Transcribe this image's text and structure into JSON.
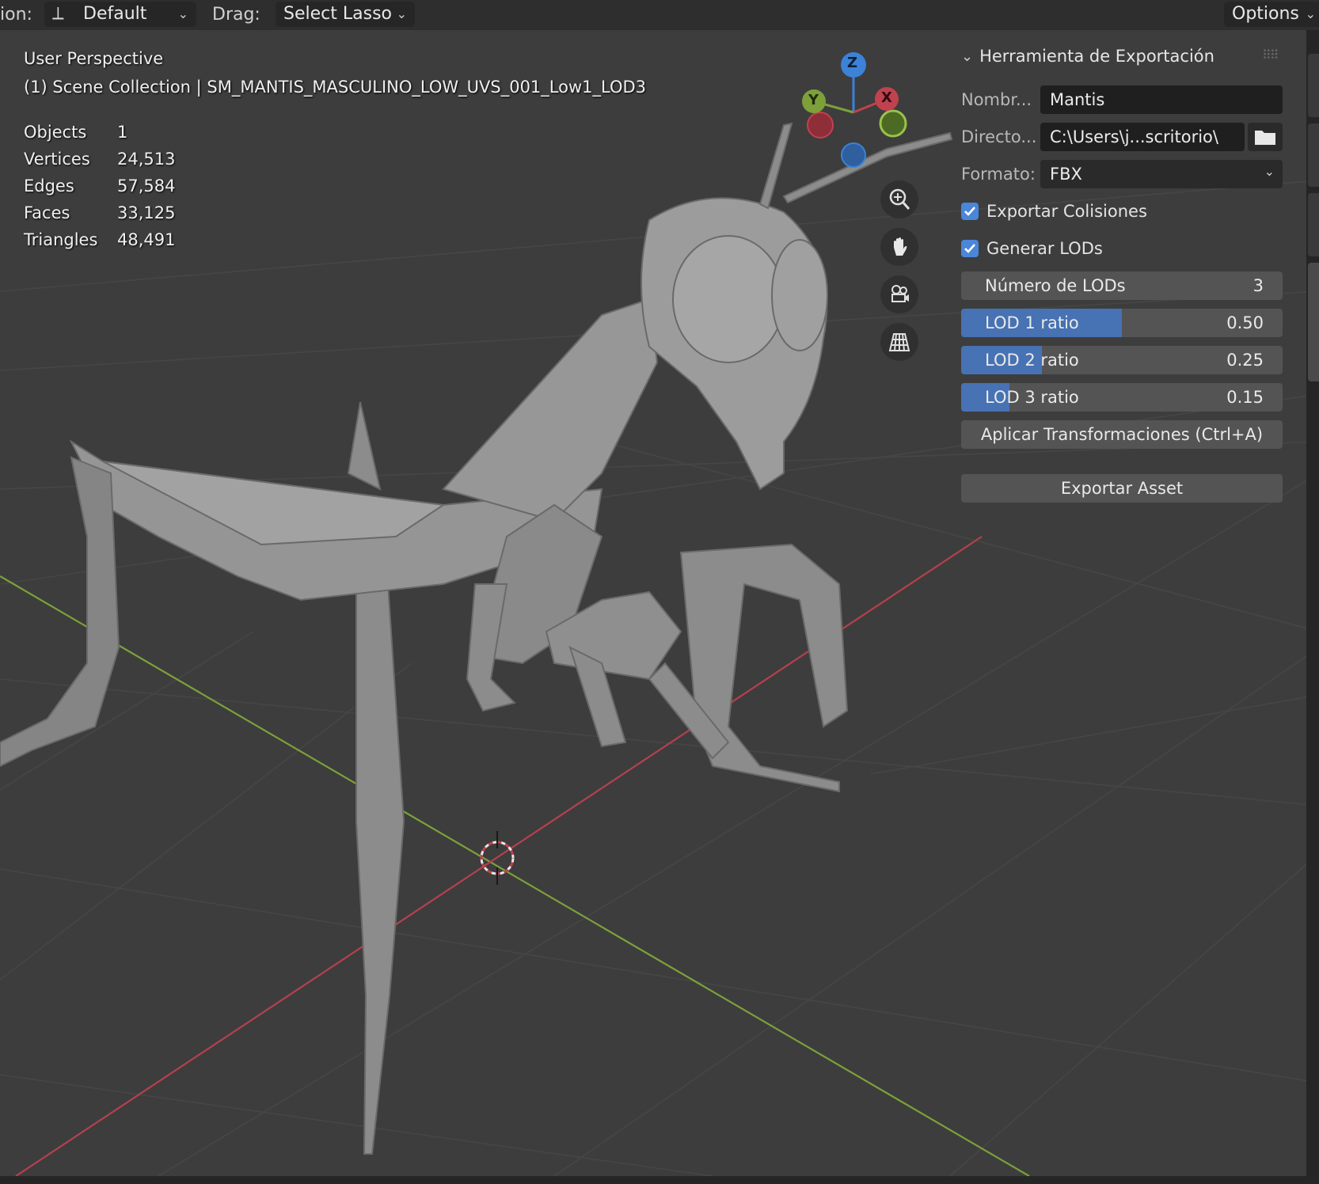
{
  "header": {
    "orientation_label": "ion:",
    "orientation_value": "Default",
    "drag_label": "Drag:",
    "drag_value": "Select Lasso",
    "options_label": "Options"
  },
  "viewport": {
    "view_name": "User Perspective",
    "collection_line": "(1) Scene Collection | SM_MANTIS_MASCULINO_LOW_UVS_001_Low1_LOD3",
    "stats": [
      {
        "label": "Objects",
        "value": "1"
      },
      {
        "label": "Vertices",
        "value": "24,513"
      },
      {
        "label": "Edges",
        "value": "57,584"
      },
      {
        "label": "Faces",
        "value": "33,125"
      },
      {
        "label": "Triangles",
        "value": "48,491"
      }
    ],
    "gizmo": {
      "z": "Z",
      "y": "Y",
      "x": "X"
    },
    "nav_icons": [
      "zoom-icon",
      "pan-hand-icon",
      "camera-icon",
      "perspective-grid-icon"
    ],
    "axis_colors": {
      "x": "#c0424f",
      "y": "#7da03a",
      "z": "#3b82d8"
    }
  },
  "panel": {
    "title": "Herramienta de Exportación",
    "name_label": "Nombr...",
    "name_value": "Mantis",
    "dir_label": "Directo...",
    "dir_value": "C:\\Users\\j...scritorio\\",
    "format_label": "Formato:",
    "format_value": "FBX",
    "export_collisions": "Exportar Colisiones",
    "generate_lods": "Generar LODs",
    "lod_count_label": "Número de LODs",
    "lod_count_value": "3",
    "lods": [
      {
        "label": "LOD 1 ratio",
        "value": "0.50",
        "fraction": 0.5
      },
      {
        "label": "LOD 2 ratio",
        "value": "0.25",
        "fraction": 0.25
      },
      {
        "label": "LOD 3 ratio",
        "value": "0.15",
        "fraction": 0.15
      }
    ],
    "apply_button": "Aplicar Transformaciones (Ctrl+A)",
    "export_button": "Exportar Asset",
    "accent": "#4772b3"
  }
}
